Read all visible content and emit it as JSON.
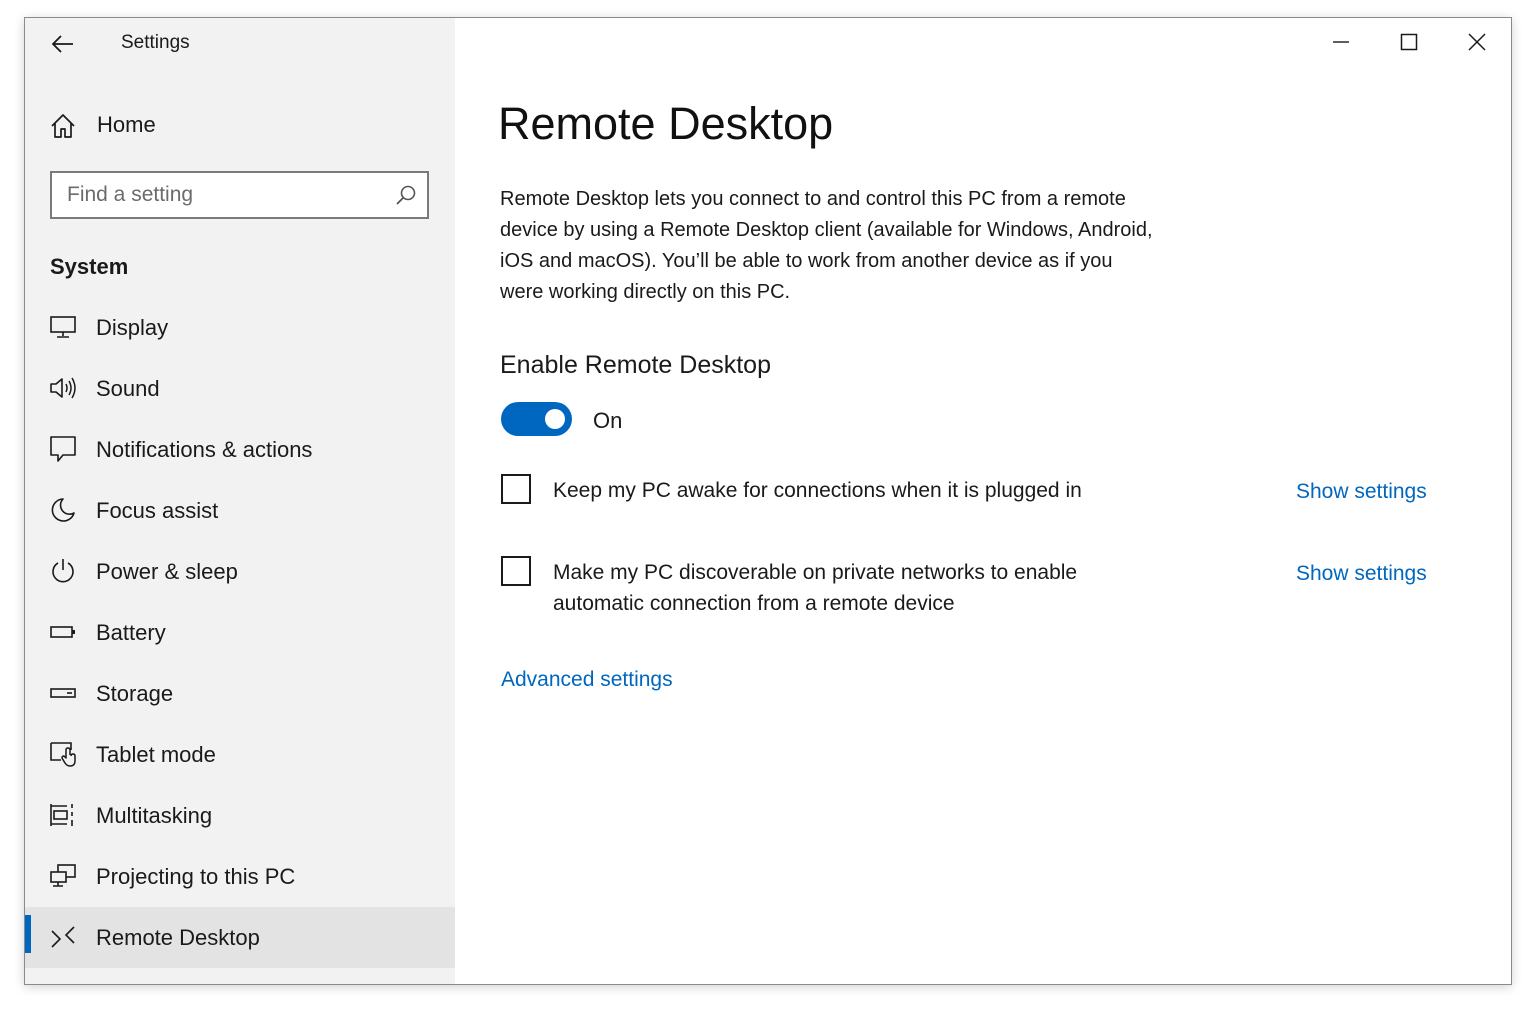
{
  "window": {
    "title": "Settings",
    "controls": {
      "minimize": "minimize-icon",
      "maximize": "maximize-icon",
      "close": "close-icon"
    }
  },
  "sidebar": {
    "home_label": "Home",
    "search": {
      "placeholder": "Find a setting",
      "value": ""
    },
    "section_title": "System",
    "items": [
      {
        "label": "Display",
        "icon": "display-icon"
      },
      {
        "label": "Sound",
        "icon": "sound-icon"
      },
      {
        "label": "Notifications & actions",
        "icon": "notifications-icon"
      },
      {
        "label": "Focus assist",
        "icon": "moon-icon"
      },
      {
        "label": "Power & sleep",
        "icon": "power-icon"
      },
      {
        "label": "Battery",
        "icon": "battery-icon"
      },
      {
        "label": "Storage",
        "icon": "storage-icon"
      },
      {
        "label": "Tablet mode",
        "icon": "tablet-mode-icon"
      },
      {
        "label": "Multitasking",
        "icon": "multitasking-icon"
      },
      {
        "label": "Projecting to this PC",
        "icon": "projecting-icon"
      },
      {
        "label": "Remote Desktop",
        "icon": "remote-desktop-icon",
        "active": true
      }
    ]
  },
  "main": {
    "title": "Remote Desktop",
    "description": "Remote Desktop lets you connect to and control this PC from a remote device by using a Remote Desktop client (available for Windows, Android, iOS and macOS). You’ll be able to work from another device as if you were working directly on this PC.",
    "enable_title": "Enable Remote Desktop",
    "toggle": {
      "state": "On",
      "on": true
    },
    "options": [
      {
        "label": "Keep my PC awake for connections when it is plugged in",
        "checked": false,
        "link": "Show settings"
      },
      {
        "label": "Make my PC discoverable on private networks to enable automatic connection from a remote device",
        "checked": false,
        "link": "Show settings"
      }
    ],
    "advanced_link": "Advanced settings"
  },
  "colors": {
    "accent": "#0067c0",
    "sidebar_bg": "#f2f2f2",
    "active_bg": "#e3e3e3"
  }
}
